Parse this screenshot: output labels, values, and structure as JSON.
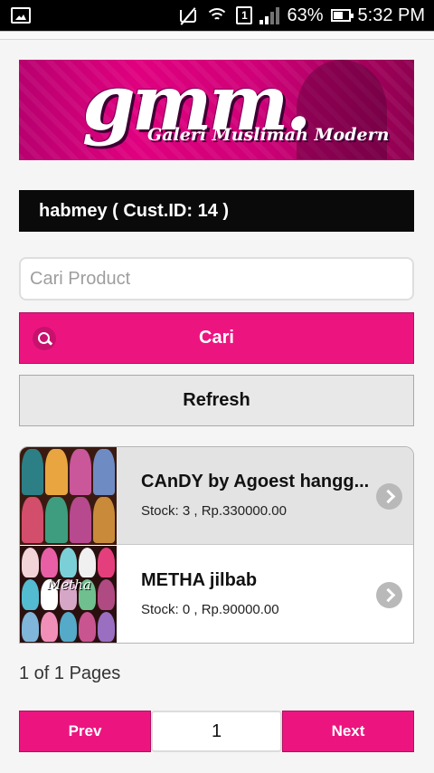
{
  "status_bar": {
    "battery": "63%",
    "time": "5:32 PM",
    "sim_slot": "1"
  },
  "banner": {
    "logo_text": "gmm.",
    "tagline": "Galeri Muslimah Modern"
  },
  "customer": {
    "label": "habmey ( Cust.ID: 14 )"
  },
  "search": {
    "placeholder": "Cari Product",
    "button_label": "Cari"
  },
  "refresh": {
    "label": "Refresh"
  },
  "products": [
    {
      "name": "CAnDY by Agoest hangg...",
      "info": "Stock: 3 , Rp.330000.00"
    },
    {
      "name": "METHA jilbab",
      "info": "Stock: 0 , Rp.90000.00",
      "thumb_text": "Metha"
    }
  ],
  "pagination": {
    "summary": "1 of 1 Pages",
    "prev_label": "Prev",
    "next_label": "Next",
    "current_page": "1"
  },
  "colors": {
    "accent": "#ec1580",
    "custbar_bg": "#0a0a0a",
    "refresh_bg": "#e8e8e8"
  },
  "icons": [
    "screenshot-icon",
    "mute-icon",
    "wifi-icon",
    "sim-icon",
    "signal-icon",
    "battery-icon",
    "search-icon",
    "chevron-right-icon"
  ]
}
